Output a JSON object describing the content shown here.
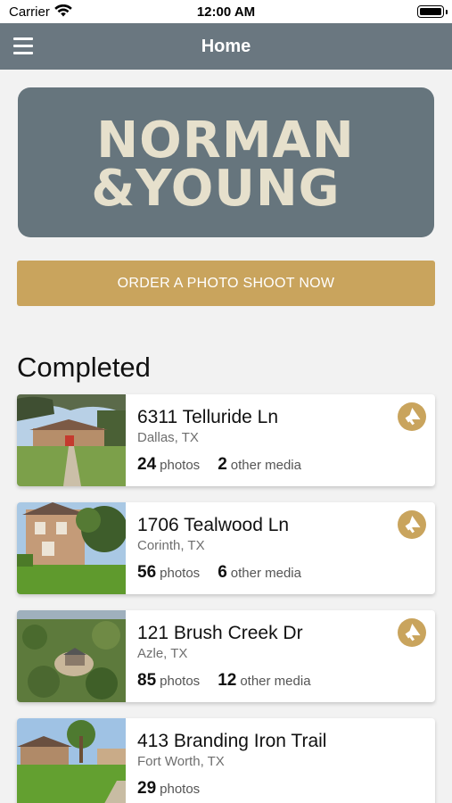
{
  "status_bar": {
    "carrier": "Carrier",
    "time": "12:00 AM"
  },
  "nav": {
    "title": "Home",
    "menu_icon": "hamburger-menu-icon"
  },
  "logo": {
    "line1": "NORMAN",
    "line2": "&YOUNG"
  },
  "order_button": {
    "label": "ORDER A PHOTO SHOOT NOW"
  },
  "section": {
    "title": "Completed"
  },
  "listings": [
    {
      "address": "6311 Telluride Ln",
      "city": "Dallas, TX",
      "photos": "24",
      "photos_label": "photos",
      "media": "2",
      "media_label": "other media",
      "promote_icon": "megaphone-icon"
    },
    {
      "address": "1706 Tealwood Ln",
      "city": "Corinth, TX",
      "photos": "56",
      "photos_label": "photos",
      "media": "6",
      "media_label": "other media",
      "promote_icon": "megaphone-icon"
    },
    {
      "address": "121 Brush Creek Dr",
      "city": "Azle, TX",
      "photos": "85",
      "photos_label": "photos",
      "media": "12",
      "media_label": "other media",
      "promote_icon": "megaphone-icon"
    },
    {
      "address": "413 Branding Iron Trail",
      "city": "Fort Worth, TX",
      "photos": "29",
      "photos_label": "photos"
    }
  ],
  "colors": {
    "nav_bar": "#6a7780",
    "logo_card": "#66757d",
    "logo_text": "#e6e0cc",
    "accent_gold": "#c9a45d",
    "background": "#f2f2f2"
  }
}
